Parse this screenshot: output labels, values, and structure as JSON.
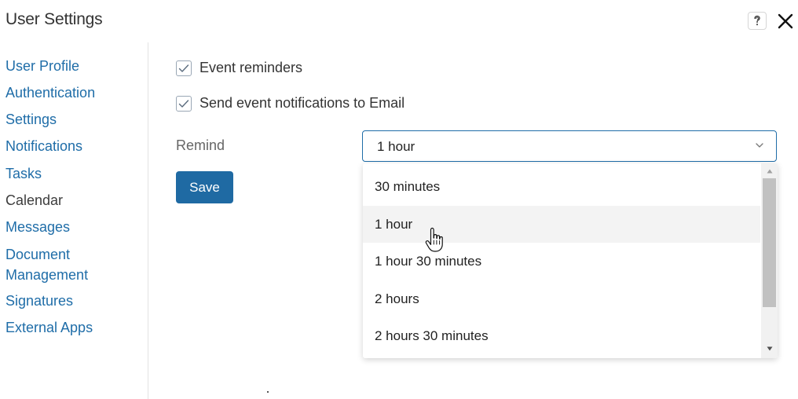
{
  "header": {
    "title": "User Settings",
    "help_icon": "question-icon",
    "close_icon": "close-icon"
  },
  "sidebar": {
    "items": [
      {
        "label": "User Profile",
        "active": false
      },
      {
        "label": "Authentication",
        "active": false
      },
      {
        "label": "Settings",
        "active": false
      },
      {
        "label": "Notifications",
        "active": false
      },
      {
        "label": "Tasks",
        "active": false
      },
      {
        "label": "Calendar",
        "active": true
      },
      {
        "label": "Messages",
        "active": false
      },
      {
        "label": "Document",
        "active": false
      },
      {
        "label": "Management",
        "active": false
      },
      {
        "label": "Signatures",
        "active": false
      },
      {
        "label": "External Apps",
        "active": false
      }
    ]
  },
  "calendar_settings": {
    "event_reminders": {
      "label": "Event reminders",
      "checked": true
    },
    "email_notifications": {
      "label": "Send event notifications to Email",
      "checked": true
    },
    "remind": {
      "label": "Remind",
      "selected": "1 hour",
      "options": [
        "30 minutes",
        "1 hour",
        "1 hour 30 minutes",
        "2 hours",
        "2 hours 30 minutes"
      ],
      "hovered_option": "1 hour"
    },
    "save_label": "Save"
  },
  "colors": {
    "link": "#1f6da8",
    "primary_button": "#1f6aa3",
    "select_border": "#1f6da8",
    "hover_row": "#f3f3f3"
  }
}
